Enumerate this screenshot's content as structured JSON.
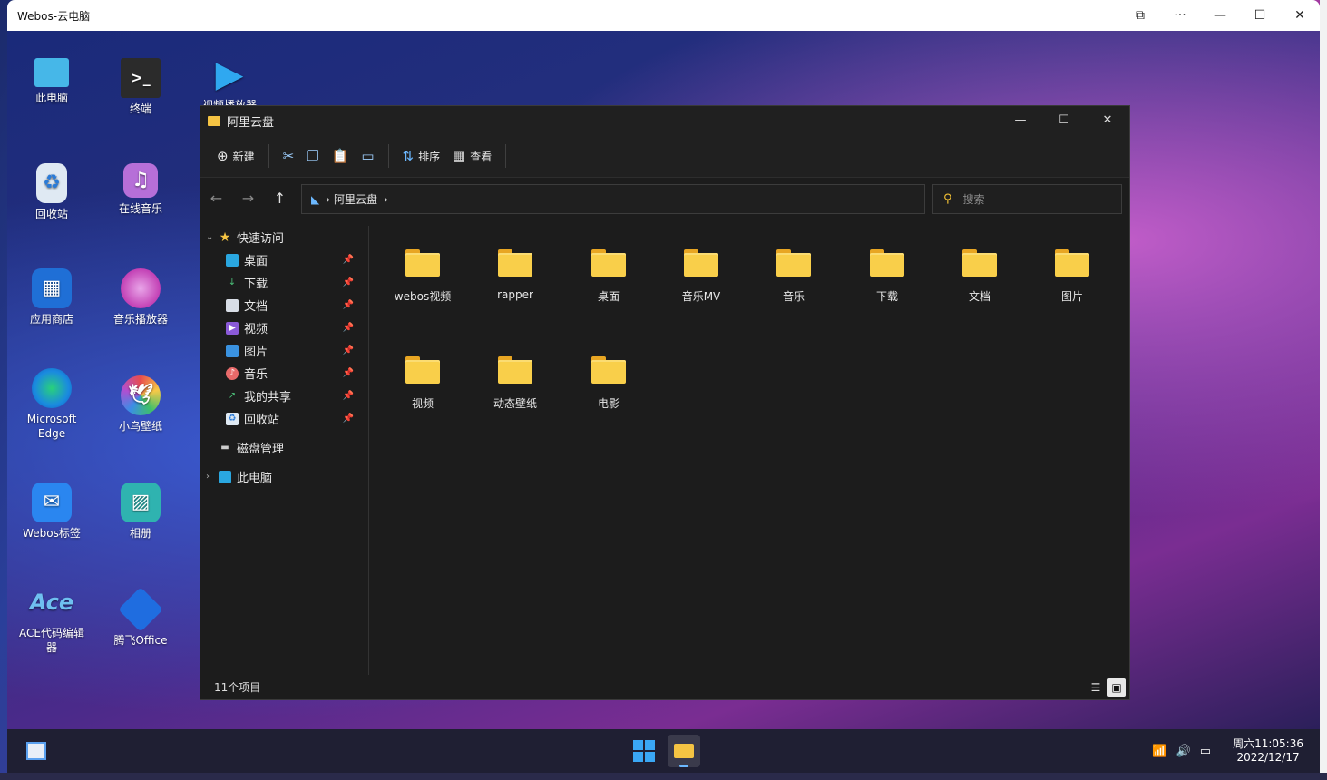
{
  "outer": {
    "title": "Webos-云电脑"
  },
  "desktop_icons": [
    {
      "label": "此电脑"
    },
    {
      "label": "终端"
    },
    {
      "label": "视频播放器"
    },
    {
      "label": "回收站"
    },
    {
      "label": "在线音乐"
    },
    {
      "label": "应用商店"
    },
    {
      "label": "音乐播放器"
    },
    {
      "label": "Microsoft Edge"
    },
    {
      "label": "小鸟壁纸"
    },
    {
      "label": "Webos标签"
    },
    {
      "label": "相册"
    },
    {
      "label": "ACE代码编辑器"
    },
    {
      "label": "腾飞Office"
    }
  ],
  "explorer": {
    "title": "阿里云盘",
    "toolbar": {
      "new_label": "新建",
      "sort_label": "排序",
      "view_label": "查看"
    },
    "address": {
      "path": "阿里云盘"
    },
    "search": {
      "placeholder": "搜索"
    },
    "sidebar": {
      "quick_access": "快速访问",
      "quick_items": [
        {
          "label": "桌面",
          "icon": "desktop-icon"
        },
        {
          "label": "下载",
          "icon": "download-icon"
        },
        {
          "label": "文档",
          "icon": "document-icon"
        },
        {
          "label": "视频",
          "icon": "video-icon"
        },
        {
          "label": "图片",
          "icon": "image-icon"
        },
        {
          "label": "音乐",
          "icon": "music-icon"
        },
        {
          "label": "我的共享",
          "icon": "share-icon"
        },
        {
          "label": "回收站",
          "icon": "recycle-bin-icon"
        }
      ],
      "disk": "磁盘管理",
      "this_pc": "此电脑"
    },
    "folders": [
      {
        "label": "webos视频"
      },
      {
        "label": "rapper"
      },
      {
        "label": "桌面"
      },
      {
        "label": "音乐MV"
      },
      {
        "label": "音乐"
      },
      {
        "label": "下载"
      },
      {
        "label": "文档"
      },
      {
        "label": "图片"
      },
      {
        "label": "视频"
      },
      {
        "label": "动态壁纸"
      },
      {
        "label": "电影"
      }
    ],
    "status": {
      "count": "11个项目"
    }
  },
  "taskbar": {
    "day_time": "周六11:05:36",
    "date": "2022/12/17"
  }
}
